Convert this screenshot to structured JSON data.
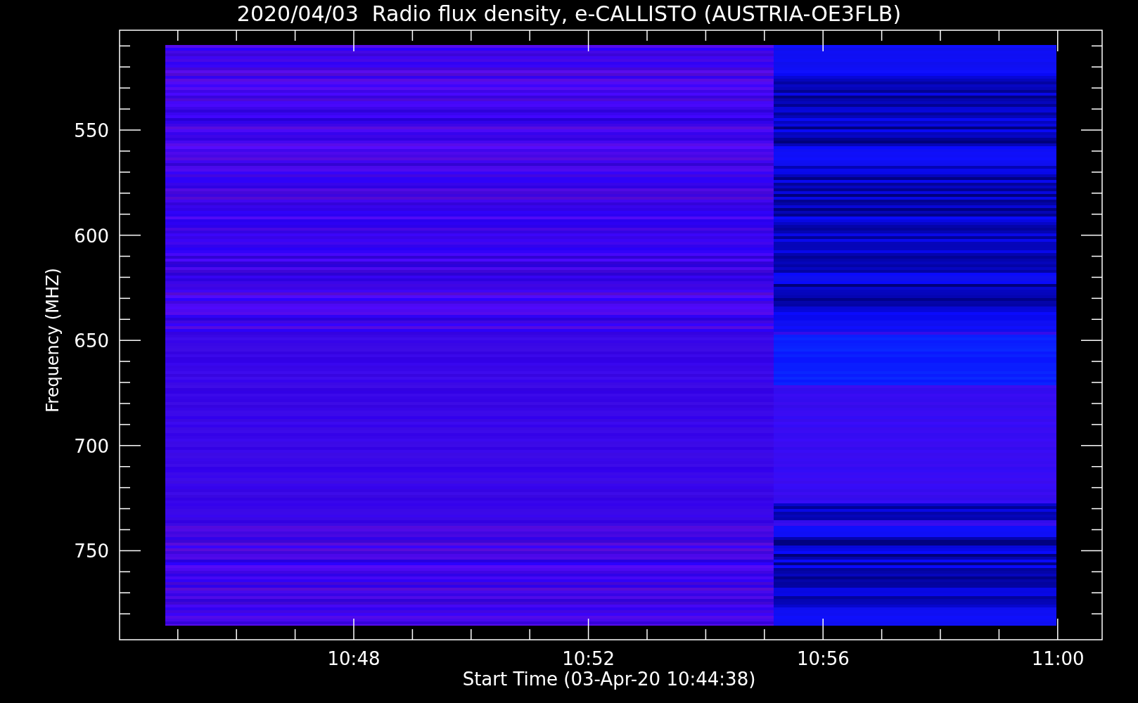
{
  "title": "2020/04/03  Radio flux density, e-CALLISTO (AUSTRIA-OE3FLB)",
  "y_axis": {
    "label": "Frequency (MHZ)",
    "ticks": [
      "550",
      "600",
      "650",
      "700",
      "750"
    ]
  },
  "x_axis": {
    "label": "Start Time (03-Apr-20 10:44:38)",
    "ticks": [
      "10:48",
      "10:52",
      "10:56",
      "11:00"
    ]
  }
}
